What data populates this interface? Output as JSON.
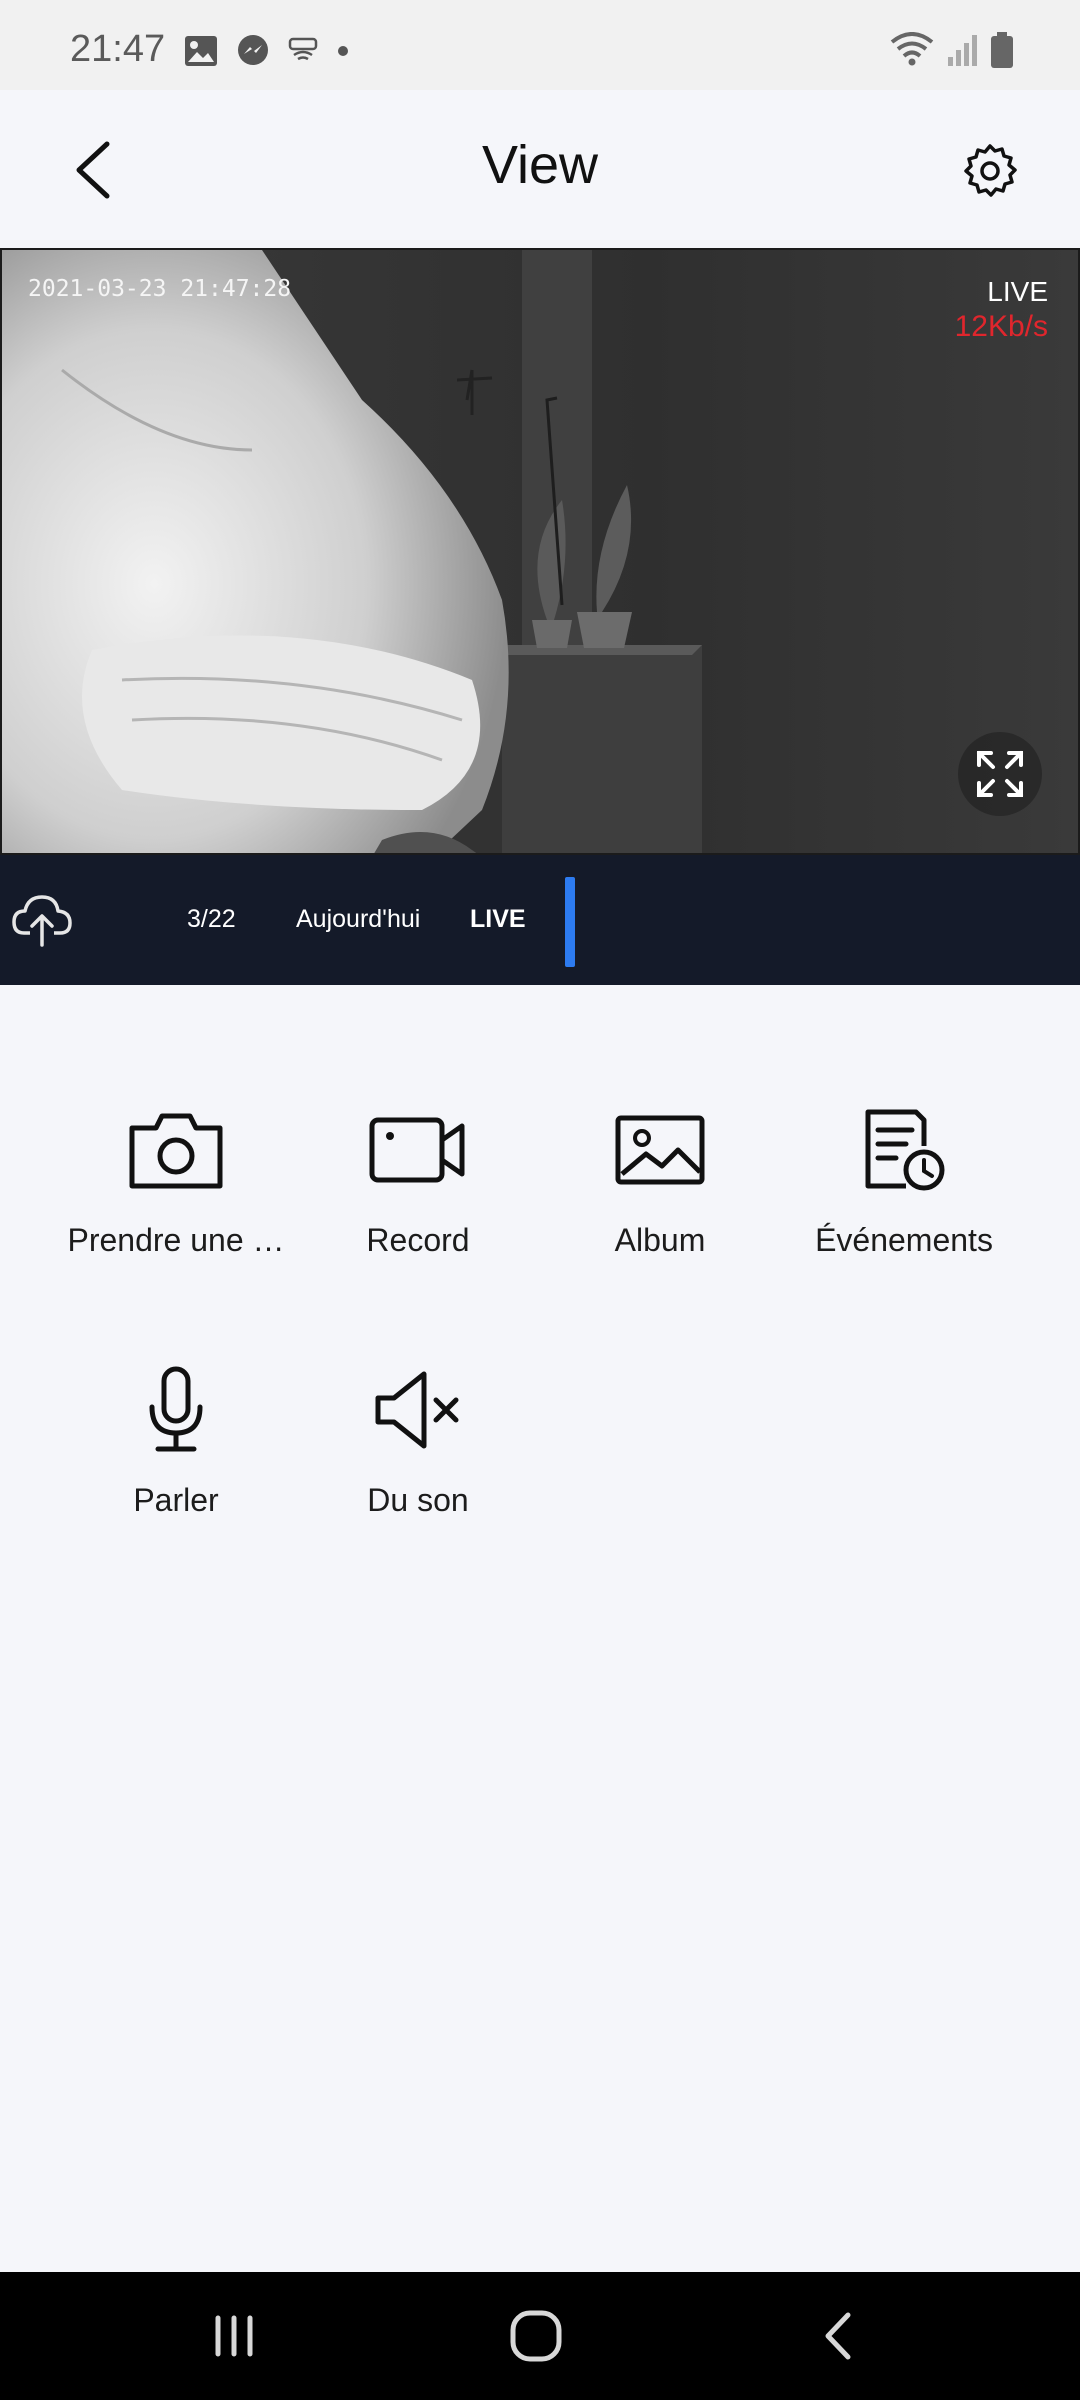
{
  "status_bar": {
    "time": "21:47",
    "left_icons": [
      "image-icon",
      "messenger-icon",
      "wifi-calling-icon",
      "dot-icon"
    ],
    "right_icons": [
      "wifi-icon",
      "signal-icon",
      "battery-icon"
    ]
  },
  "header": {
    "title": "View",
    "back_icon": "chevron-left-icon",
    "settings_icon": "gear-icon"
  },
  "camera": {
    "timestamp": "2021-03-23 21:47:28",
    "live_label": "LIVE",
    "bitrate": "12Kb/s",
    "bitrate_color": "#e0262d",
    "fullscreen_icon": "expand-icon"
  },
  "timeline": {
    "cloud_icon": "cloud-upload-icon",
    "date": "3/22",
    "today": "Aujourd'hui",
    "live": "LIVE",
    "indicator_color": "#2d7bf0"
  },
  "actions": [
    {
      "label": "Prendre une …",
      "icon": "camera-icon"
    },
    {
      "label": "Record",
      "icon": "video-camera-icon"
    },
    {
      "label": "Album",
      "icon": "image-icon"
    },
    {
      "label": "Événements",
      "icon": "events-document-clock-icon"
    },
    {
      "label": "Parler",
      "icon": "microphone-icon"
    },
    {
      "label": "Du son",
      "icon": "speaker-muted-icon"
    }
  ],
  "nav_bar": {
    "recents_icon": "recents-icon",
    "home_icon": "home-icon",
    "back_icon": "back-icon"
  }
}
